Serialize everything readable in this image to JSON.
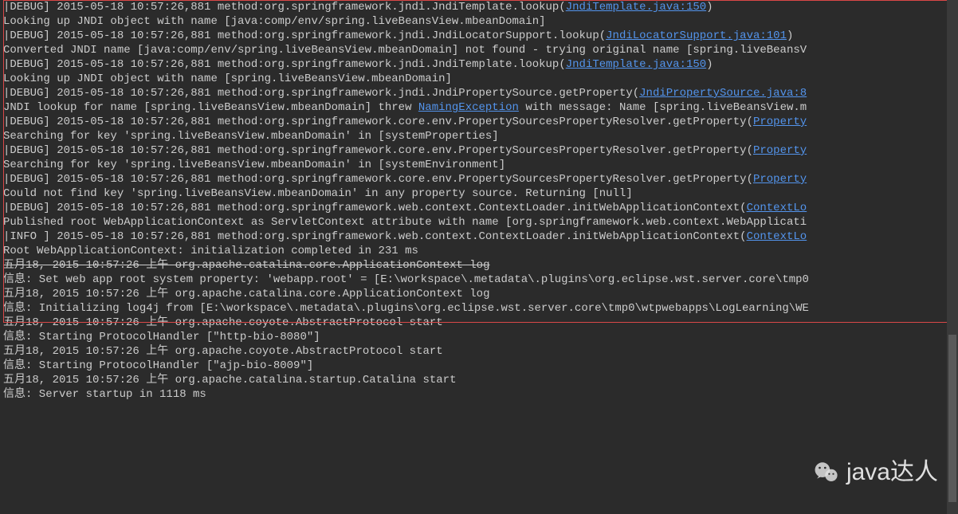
{
  "lines": [
    {
      "segments": [
        {
          "t": "|"
        },
        {
          "t": "DEBUG",
          "cls": "dbg"
        },
        {
          "t": "] 2015-05-18 10:57:26,881 method:org.springframework.jndi.JndiTemplate.lookup("
        },
        {
          "t": "JndiTemplate.java:150",
          "link": true
        },
        {
          "t": ")"
        }
      ]
    },
    {
      "segments": [
        {
          "t": "Looking up JNDI object with name [java:comp/env/spring.liveBeansView.mbeanDomain]"
        }
      ]
    },
    {
      "segments": [
        {
          "t": "|"
        },
        {
          "t": "DEBUG",
          "cls": "dbg"
        },
        {
          "t": "] 2015-05-18 10:57:26,881 method:org.springframework.jndi.JndiLocatorSupport.lookup("
        },
        {
          "t": "JndiLocatorSupport.java:101",
          "link": true
        },
        {
          "t": ")"
        }
      ]
    },
    {
      "segments": [
        {
          "t": "Converted JNDI name [java:comp/env/spring.liveBeansView.mbeanDomain] not found - trying original name [spring.liveBeansV"
        }
      ]
    },
    {
      "segments": [
        {
          "t": "|"
        },
        {
          "t": "DEBUG",
          "cls": "dbg"
        },
        {
          "t": "] 2015-05-18 10:57:26,881 method:org.springframework.jndi.JndiTemplate.lookup("
        },
        {
          "t": "JndiTemplate.java:150",
          "link": true
        },
        {
          "t": ")"
        }
      ]
    },
    {
      "segments": [
        {
          "t": "Looking up JNDI object with name [spring.liveBeansView.mbeanDomain]"
        }
      ]
    },
    {
      "segments": [
        {
          "t": "|"
        },
        {
          "t": "DEBUG",
          "cls": "dbg"
        },
        {
          "t": "] 2015-05-18 10:57:26,881 method:org.springframework.jndi.JndiPropertySource.getProperty("
        },
        {
          "t": "JndiPropertySource.java:8",
          "link": true
        }
      ]
    },
    {
      "segments": [
        {
          "t": "JNDI lookup for name [spring.liveBeansView.mbeanDomain] threw "
        },
        {
          "t": "NamingException",
          "link": true
        },
        {
          "t": " with message: Name [spring.liveBeansView.m"
        }
      ]
    },
    {
      "segments": [
        {
          "t": "|"
        },
        {
          "t": "DEBUG",
          "cls": "dbg"
        },
        {
          "t": "] 2015-05-18 10:57:26,881 method:org.springframework.core.env.PropertySourcesPropertyResolver.getProperty("
        },
        {
          "t": "Property",
          "link": true
        }
      ]
    },
    {
      "segments": [
        {
          "t": "Searching for key 'spring.liveBeansView.mbeanDomain' in [systemProperties]"
        }
      ]
    },
    {
      "segments": [
        {
          "t": "|"
        },
        {
          "t": "DEBUG",
          "cls": "dbg"
        },
        {
          "t": "] 2015-05-18 10:57:26,881 method:org.springframework.core.env.PropertySourcesPropertyResolver.getProperty("
        },
        {
          "t": "Property",
          "link": true
        }
      ]
    },
    {
      "segments": [
        {
          "t": "Searching for key 'spring.liveBeansView.mbeanDomain' in [systemEnvironment]"
        }
      ]
    },
    {
      "segments": [
        {
          "t": "|"
        },
        {
          "t": "DEBUG",
          "cls": "dbg"
        },
        {
          "t": "] 2015-05-18 10:57:26,881 method:org.springframework.core.env.PropertySourcesPropertyResolver.getProperty("
        },
        {
          "t": "Property",
          "link": true
        }
      ]
    },
    {
      "segments": [
        {
          "t": "Could not find key 'spring.liveBeansView.mbeanDomain' in any property source. Returning [null]"
        }
      ]
    },
    {
      "segments": [
        {
          "t": "|"
        },
        {
          "t": "DEBUG",
          "cls": "dbg"
        },
        {
          "t": "] 2015-05-18 10:57:26,881 method:org.springframework.web.context.ContextLoader.initWebApplicationContext("
        },
        {
          "t": "ContextLo",
          "link": true
        }
      ]
    },
    {
      "segments": [
        {
          "t": "Published root WebApplicationContext as ServletContext attribute with name [org.springframework.web.context.WebApplicati"
        }
      ]
    },
    {
      "segments": [
        {
          "t": "|"
        },
        {
          "t": "INFO ",
          "cls": "dbg"
        },
        {
          "t": "] 2015-05-18 10:57:26,881 method:org.springframework.web.context.ContextLoader.initWebApplicationContext("
        },
        {
          "t": "ContextLo",
          "link": true
        }
      ]
    },
    {
      "segments": [
        {
          "t": "Root WebApplicationContext: initialization completed in 231 ms"
        }
      ]
    },
    {
      "segments": [
        {
          "t": "五月18, 2015 10:57:26 上午 org.apache.catalina.core.ApplicationContext log",
          "strike": true
        }
      ]
    },
    {
      "segments": [
        {
          "t": "信息: Set web app root system property: 'webapp.root' = [E:\\workspace\\.metadata\\.plugins\\org.eclipse.wst.server.core\\tmp0"
        }
      ]
    },
    {
      "segments": [
        {
          "t": "五月18, 2015 10:57:26 上午 org.apache.catalina.core.ApplicationContext log"
        }
      ]
    },
    {
      "segments": [
        {
          "t": "信息: Initializing log4j from [E:\\workspace\\.metadata\\.plugins\\org.eclipse.wst.server.core\\tmp0\\wtpwebapps\\LogLearning\\WE"
        }
      ]
    },
    {
      "segments": [
        {
          "t": "五月18, 2015 10:57:26 上午 org.apache.coyote.AbstractProtocol start"
        }
      ]
    },
    {
      "segments": [
        {
          "t": "信息: Starting ProtocolHandler [\"http-bio-8080\"]"
        }
      ]
    },
    {
      "segments": [
        {
          "t": "五月18, 2015 10:57:26 上午 org.apache.coyote.AbstractProtocol start"
        }
      ]
    },
    {
      "segments": [
        {
          "t": "信息: Starting ProtocolHandler [\"ajp-bio-8009\"]"
        }
      ]
    },
    {
      "segments": [
        {
          "t": "五月18, 2015 10:57:26 上午 org.apache.catalina.startup.Catalina start"
        }
      ]
    },
    {
      "segments": [
        {
          "t": "信息: Server startup in 1118 ms"
        }
      ]
    }
  ],
  "watermark": {
    "text": "java达人"
  }
}
